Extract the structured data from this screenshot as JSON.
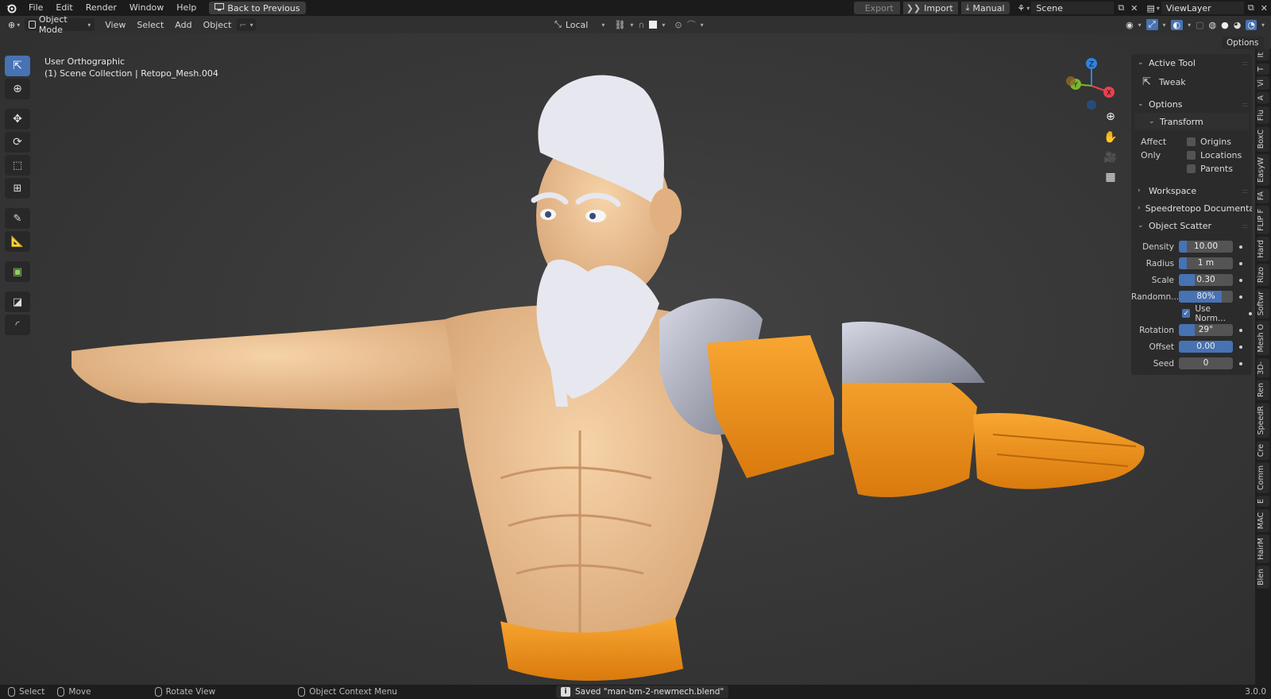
{
  "topbar": {
    "menu": [
      "File",
      "Edit",
      "Render",
      "Window",
      "Help"
    ],
    "back_button": "Back to Previous",
    "export_label": "Export",
    "import_label": "Import",
    "manual_label": "Manual",
    "scene_name": "Scene",
    "view_layer": "ViewLayer"
  },
  "header": {
    "mode": "Object Mode",
    "menu": [
      "View",
      "Select",
      "Add",
      "Object"
    ],
    "transform_orientation": "Local",
    "options_label": "Options"
  },
  "viewport": {
    "view_name": "User Orthographic",
    "collection_line": "(1) Scene Collection | Retopo_Mesh.004",
    "gizmo_axes": [
      "Z",
      "Y",
      "X"
    ]
  },
  "npanel": {
    "active_tool_title": "Active Tool",
    "active_tool_name": "Tweak",
    "options_title": "Options",
    "transform_title": "Transform",
    "affect_only_label": "Affect Only",
    "affect_only": [
      {
        "label": "Origins",
        "checked": false
      },
      {
        "label": "Locations",
        "checked": false
      },
      {
        "label": "Parents",
        "checked": false
      }
    ],
    "workspace_title": "Workspace",
    "speedretopo_title": "Speedretopo Documentation",
    "scatter_title": "Object Scatter",
    "scatter_props": [
      {
        "label": "Density",
        "value": "10.00",
        "fill": 0.15
      },
      {
        "label": "Radius",
        "value": "1 m",
        "fill": 0.15
      },
      {
        "label": "Scale",
        "value": "0.30",
        "fill": 0.3
      },
      {
        "label": "Randomn...",
        "value": "80%",
        "fill": 0.8
      }
    ],
    "use_normals_label": "Use Norm...",
    "use_normals_checked": true,
    "scatter_props2": [
      {
        "label": "Rotation",
        "value": "29°",
        "fill": 0.3
      },
      {
        "label": "Offset",
        "value": "0.00",
        "fill": 1.0
      },
      {
        "label": "Seed",
        "value": "0",
        "fill": 0.0
      }
    ]
  },
  "side_tabs": [
    "It",
    "T",
    "Vi",
    "A",
    "Flu",
    "BoxC",
    "EasyW",
    "FA",
    "FLIP F",
    "Hard",
    "Rizo",
    "Softwr",
    "Mesh O",
    "3D-",
    "Ren",
    "SpeedR",
    "Cre",
    "Comm",
    "E",
    "MAC",
    "HairM",
    "Blen"
  ],
  "status": {
    "select": "Select",
    "move": "Move",
    "rotate": "Rotate View",
    "context": "Object Context Menu",
    "saved_message": "Saved \"man-bm-2-newmech.blend\"",
    "version": "3.0.0"
  },
  "colors": {
    "accent": "#4772b3",
    "axis_x": "#e8414f",
    "axis_y": "#7ab82e",
    "axis_z": "#2f83e0",
    "skin": "#f0c595",
    "mech_orange": "#f29418",
    "hair_white": "#e7e7ef"
  }
}
